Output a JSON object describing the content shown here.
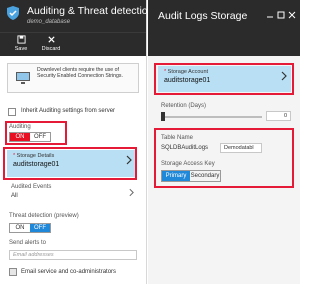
{
  "left": {
    "title": "Auditing & Threat detection",
    "subtitle": "demo_database",
    "toolbar": {
      "save": "Save",
      "discard": "Discard"
    },
    "info": "Downlevel clients require the use of Security Enabled Connection Strings.",
    "inherit": "Inherit Auditing settings from server",
    "auditing_label": "Auditing",
    "auditing_on": "ON",
    "auditing_off": "OFF",
    "storage_label": "Storage Details",
    "storage_value": "auditstorage01",
    "audited_events_label": "Audited Events",
    "audited_events_value": "All",
    "threat_label": "Threat detection (preview)",
    "threat_on": "ON",
    "threat_off": "OFF",
    "send_alerts_label": "Send alerts to",
    "send_alerts_placeholder": "Email addresses",
    "email_admins": "Email service and co-administrators"
  },
  "right": {
    "title": "Audit Logs Storage",
    "storage_account_label": "Storage Account",
    "storage_account_value": "auditstorage01",
    "retention_label": "Retention (Days)",
    "retention_value": "0",
    "table_name_label": "Table Name",
    "table_prefix": "SQLDBAuditLogs",
    "table_value": "Demodatabl",
    "access_key_label": "Storage Access Key",
    "key_primary": "Primary",
    "key_secondary": "Secondary"
  },
  "colors": {
    "accent_red": "#e41a37",
    "accent_blue": "#2088d8",
    "blade_bg": "#b9dff4",
    "chrome": "#2b2b2b"
  }
}
